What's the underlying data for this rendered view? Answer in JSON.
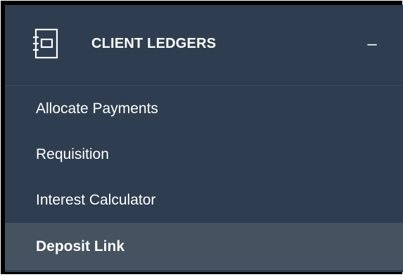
{
  "panel": {
    "title": "CLIENT LEDGERS",
    "header_icon": "ledger-book-icon",
    "collapse_glyph": "–",
    "items": [
      {
        "label": "Allocate Payments",
        "active": false
      },
      {
        "label": "Requisition",
        "active": false
      },
      {
        "label": "Interest Calculator",
        "active": false
      },
      {
        "label": "Deposit Link",
        "active": true
      }
    ]
  },
  "colors": {
    "panel_bg": "#2e3d4f",
    "active_item_bg": "#45525f",
    "text": "#ffffff"
  }
}
